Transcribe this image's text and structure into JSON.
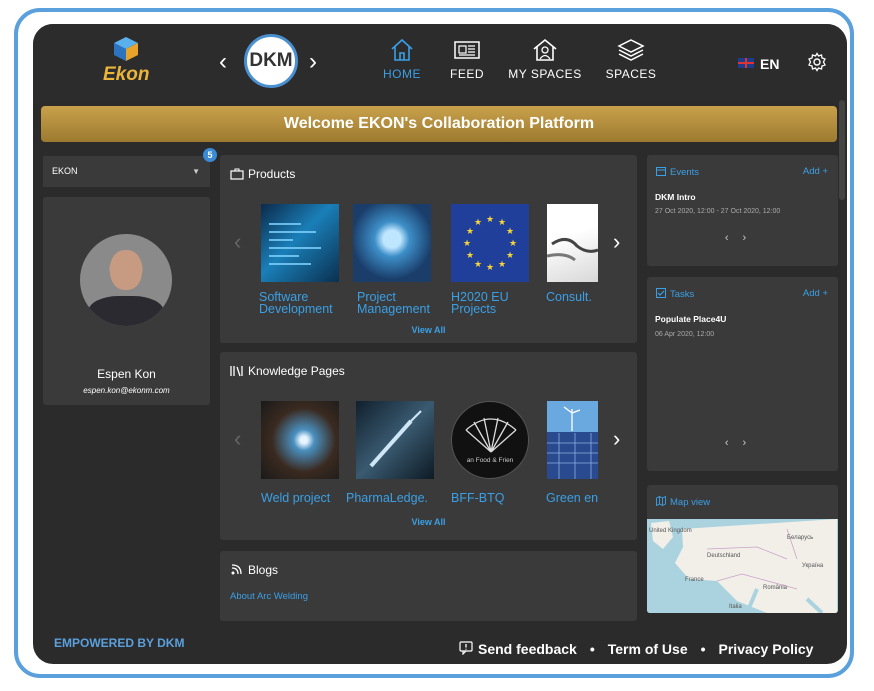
{
  "app": {
    "logo_text": "Ekon",
    "center_logo": "DKM"
  },
  "nav": [
    {
      "label": "HOME",
      "icon": "home-icon",
      "active": true
    },
    {
      "label": "FEED",
      "icon": "newspaper-icon",
      "active": false
    },
    {
      "label": "MY SPACES",
      "icon": "my-spaces-icon",
      "active": false
    },
    {
      "label": "SPACES",
      "icon": "layers-icon",
      "active": false
    }
  ],
  "language": "EN",
  "banner": "Welcome EKON's Collaboration Platform",
  "space_select": {
    "value": "EKON",
    "badge": "5"
  },
  "profile": {
    "name": "Espen Kon",
    "email": "espen.kon@ekonm.com"
  },
  "products": {
    "title": "Products",
    "items": [
      {
        "label_1": "Software",
        "label_2": "Development"
      },
      {
        "label_1": "Project",
        "label_2": "Management"
      },
      {
        "label_1": "H2020 EU",
        "label_2": "Projects"
      },
      {
        "label_1": "Consult.",
        "label_2": ""
      }
    ],
    "view_all": "View All"
  },
  "knowledge": {
    "title": "Knowledge Pages",
    "items": [
      {
        "label": "Weld project"
      },
      {
        "label": "PharmaLedge."
      },
      {
        "label": "BFF-BTQ",
        "logo_text": "an Food & Frien"
      },
      {
        "label": "Green en"
      }
    ],
    "view_all": "View All"
  },
  "blogs": {
    "title": "Blogs",
    "link": "About Arc Welding"
  },
  "events": {
    "title": "Events",
    "add": "Add +",
    "item": "DKM Intro",
    "date": "27 Oct 2020, 12:00 - 27 Oct 2020, 12:00"
  },
  "tasks": {
    "title": "Tasks",
    "add": "Add +",
    "item": "Populate Place4U",
    "date": "06 Apr 2020, 12:00"
  },
  "map": {
    "title": "Map view",
    "labels": [
      "United Kingdom",
      "Беларусь",
      "Deutschland",
      "France",
      "Україна",
      "România",
      "Italia"
    ]
  },
  "footer": {
    "powered": "EMPOWERED BY DKM",
    "feedback": "Send feedback",
    "terms": "Term of Use",
    "privacy": "Privacy Policy",
    "separator": "•"
  },
  "colors": {
    "accent": "#3aa0e6",
    "panel": "#3a3a3a",
    "background": "#2b2b2b",
    "banner": "#b8913f",
    "frame": "#5aa0dc"
  }
}
